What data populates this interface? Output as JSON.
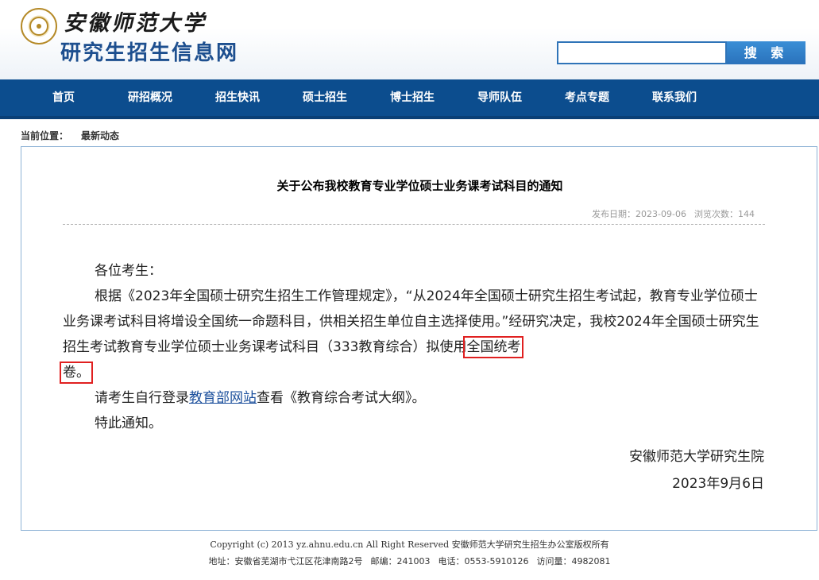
{
  "header": {
    "university_name": "安徽师范大学",
    "site_name": "研究生招生信息网",
    "search": {
      "placeholder": "",
      "value": "",
      "button_label": "搜 索"
    }
  },
  "nav": {
    "items": [
      {
        "label": "首页"
      },
      {
        "label": "研招概况"
      },
      {
        "label": "招生快讯"
      },
      {
        "label": "硕士招生"
      },
      {
        "label": "博士招生"
      },
      {
        "label": "导师队伍"
      },
      {
        "label": "考点专题"
      },
      {
        "label": "联系我们"
      }
    ]
  },
  "breadcrumb": {
    "prefix": "当前位置：",
    "current": "最新动态"
  },
  "article": {
    "title": "关于公布我校教育专业学位硕士业务课考试科目的通知",
    "meta": {
      "date_label": "发布日期：2023-09-06",
      "views_label": "浏览次数：144"
    },
    "greeting": "各位考生：",
    "para1_main": "根据《2023年全国硕士研究生招生工作管理规定》，“从2024年全国硕士研究生招生考试起，教育专业学位硕士业务课考试科目将增设全国统一命题科目，供相关招生单位自主选择使用。”经研究决定，我校2024年全国硕士研究生招生考试教育专业学位硕士业务课考试科目（333教育综合）拟使用",
    "para1_highlight_1": "全国统考",
    "para1_highlight_2": "卷。",
    "para2_before": "请考生自行登录",
    "para2_link": "教育部网站",
    "para2_after": "查看《教育综合考试大纲》。",
    "closing": "特此通知。",
    "signature": "安徽师范大学研究生院",
    "sign_date": "2023年9月6日"
  },
  "footer": {
    "copyright": "Copyright (c) 2013 yz.ahnu.edu.cn All Right Reserved 安徽师范大学研究生招生办公室版权所有",
    "address": "地址：安徽省芜湖市弋江区花津南路2号",
    "postcode": "邮编：241003",
    "phone": "电话：0553-5910126",
    "visits": "访问量：4982081"
  },
  "colors": {
    "nav_bg": "#0c4d8e",
    "site_name": "#1d4f8f",
    "search_button": "#2a72bb",
    "highlight_box": "#e02020",
    "link": "#1b4f9c"
  }
}
